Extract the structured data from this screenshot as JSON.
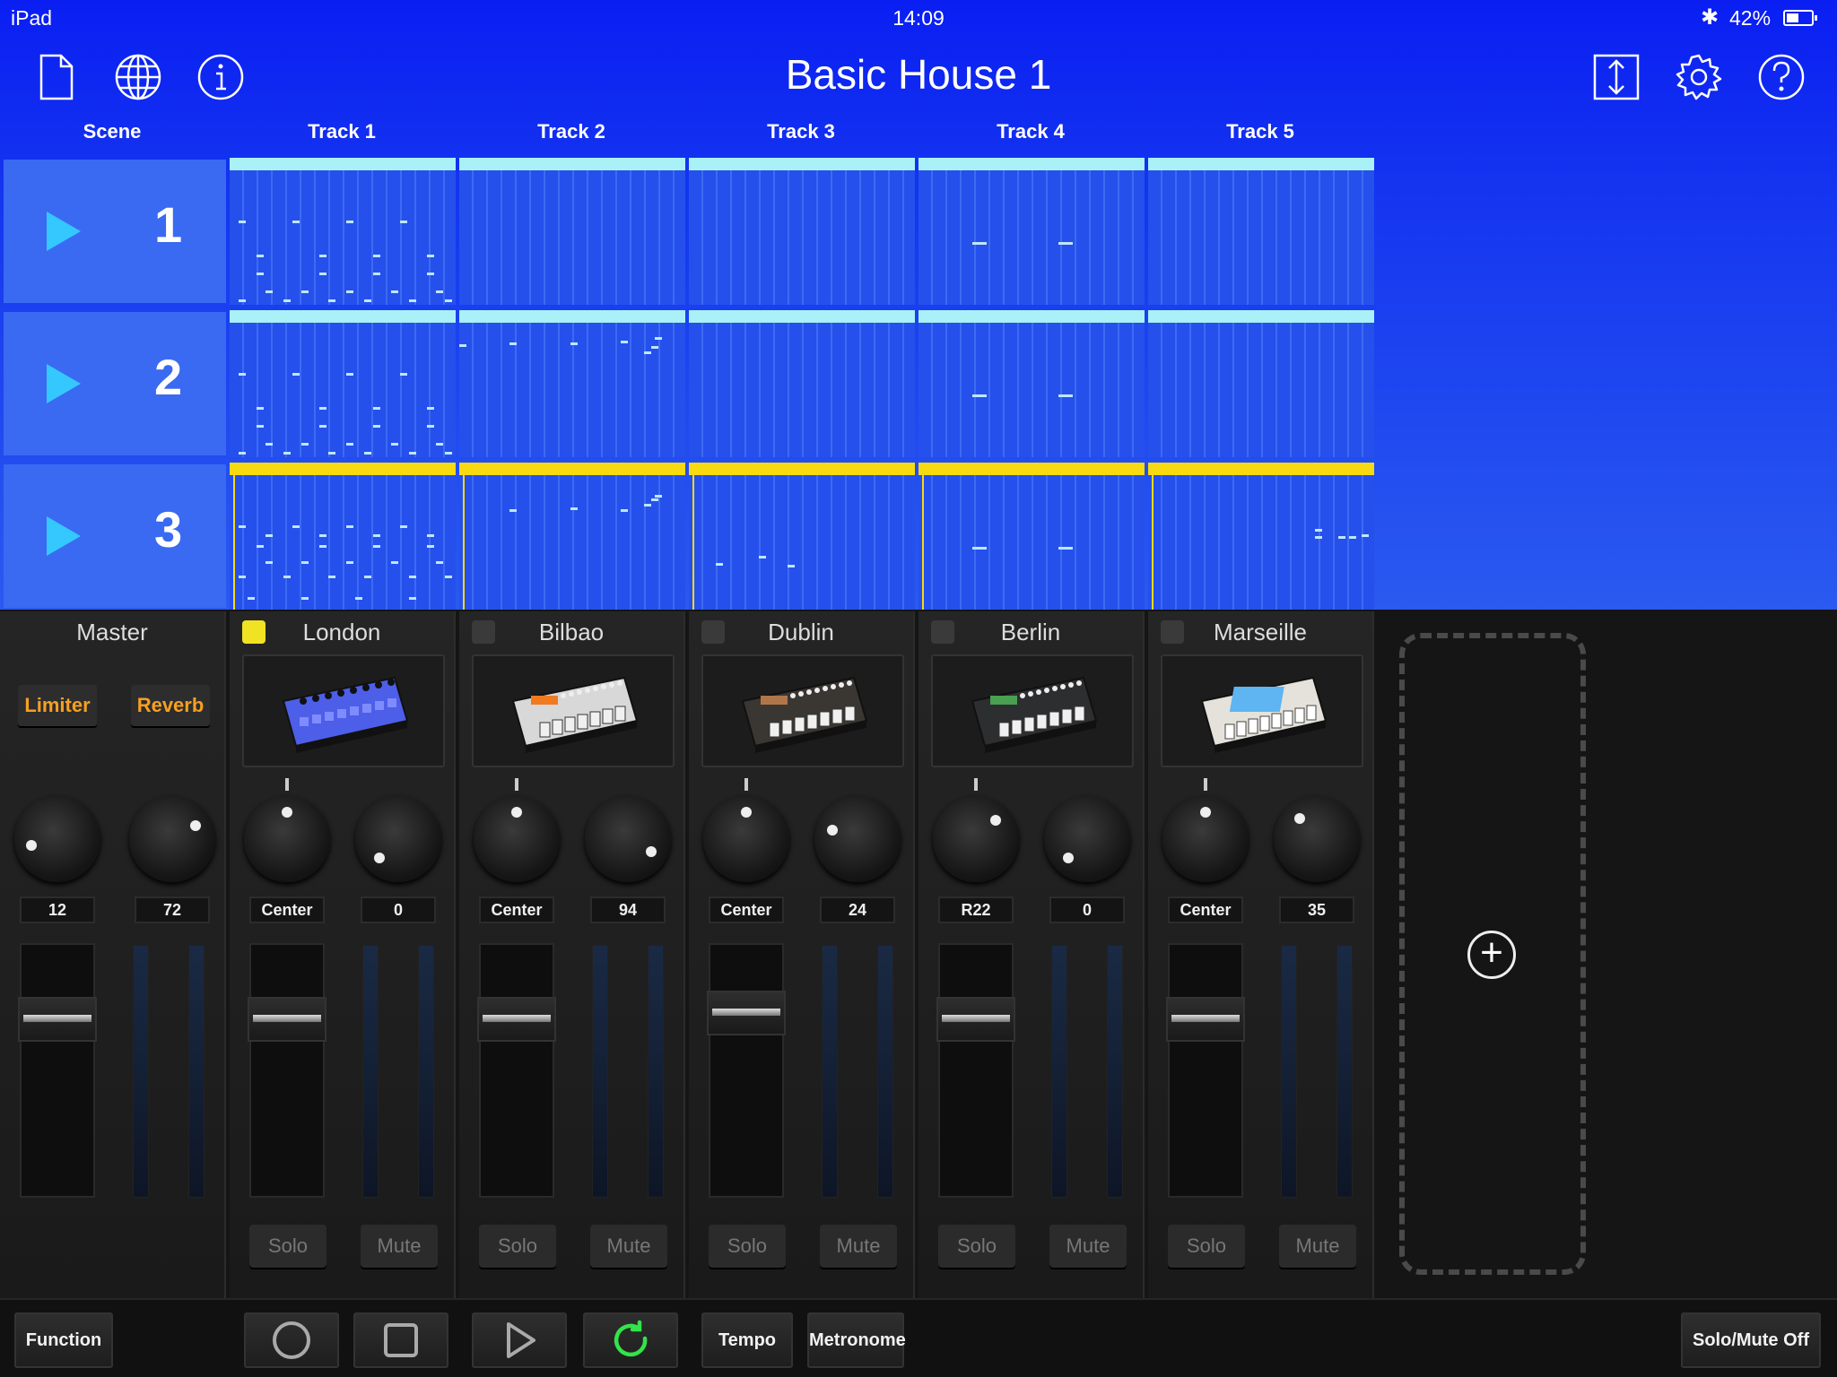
{
  "status_bar": {
    "device": "iPad",
    "time": "14:09",
    "battery": "42%",
    "battery_level": 0.42
  },
  "header": {
    "title": "Basic House 1",
    "icons": [
      "new-document-icon",
      "globe-icon",
      "info-icon",
      "resize-icon",
      "gear-icon",
      "help-icon"
    ]
  },
  "columns": {
    "scene": "Scene",
    "tracks": [
      "Track 1",
      "Track 2",
      "Track 3",
      "Track 4",
      "Track 5"
    ]
  },
  "scenes": [
    {
      "number": "1",
      "playing": false
    },
    {
      "number": "2",
      "playing": false
    },
    {
      "number": "3",
      "playing": true
    }
  ],
  "master": {
    "name": "Master",
    "fx": [
      "Limiter",
      "Reverb"
    ],
    "values": [
      "12",
      "72"
    ],
    "knob_levels": [
      0.12,
      0.72
    ],
    "fader_level": 0.75
  },
  "tracks": [
    {
      "name": "London",
      "selected": true,
      "pan": "Center",
      "send": "0",
      "pan_level": 0.5,
      "send_level": 0.0,
      "fader_level": 0.75,
      "solo": "Solo",
      "mute": "Mute"
    },
    {
      "name": "Bilbao",
      "selected": false,
      "pan": "Center",
      "send": "94",
      "pan_level": 0.5,
      "send_level": 0.94,
      "fader_level": 0.75,
      "solo": "Solo",
      "mute": "Mute"
    },
    {
      "name": "Dublin",
      "selected": false,
      "pan": "Center",
      "send": "24",
      "pan_level": 0.5,
      "send_level": 0.24,
      "fader_level": 0.78,
      "solo": "Solo",
      "mute": "Mute"
    },
    {
      "name": "Berlin",
      "selected": false,
      "pan": "R22",
      "send": "0",
      "pan_level": 0.67,
      "send_level": 0.0,
      "fader_level": 0.75,
      "solo": "Solo",
      "mute": "Mute"
    },
    {
      "name": "Marseille",
      "selected": false,
      "pan": "Center",
      "send": "35",
      "pan_level": 0.5,
      "send_level": 0.35,
      "fader_level": 0.75,
      "solo": "Solo",
      "mute": "Mute"
    }
  ],
  "bottom_bar": {
    "function": "Function",
    "tempo": "Tempo",
    "metronome": "Metronome",
    "solo_mute_off": "Solo/Mute Off",
    "transport_icons": [
      "record-icon",
      "stop-icon",
      "play-icon",
      "loop-icon"
    ],
    "loop_color": "#34e24a"
  },
  "colors": {
    "accent_blue": "#1434f0",
    "playing_yellow": "#f8da10",
    "clip_bar_cyan": "#a9f1f7",
    "fx_orange": "#f7a020"
  }
}
